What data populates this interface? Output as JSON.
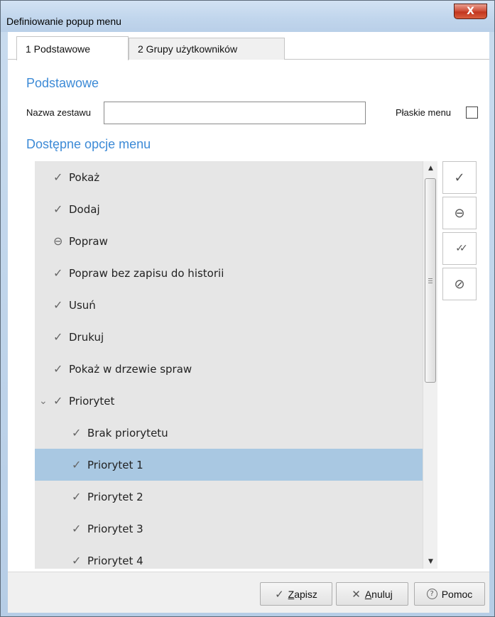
{
  "window": {
    "title": "Definiowanie popup menu",
    "close_glyph": "X"
  },
  "tabs": [
    {
      "label": "1 Podstawowe",
      "active": true
    },
    {
      "label": "2 Grupy użytkowników",
      "active": false
    }
  ],
  "basic_section": {
    "title": "Podstawowe",
    "name_label": "Nazwa zestawu",
    "name_value": "",
    "flat_menu_label": "Płaskie menu",
    "flat_menu_checked": false
  },
  "menu_section": {
    "title": "Dostępne opcje menu",
    "items": [
      {
        "label": "Pokaż",
        "icon": "check-icon",
        "glyph": "✓",
        "indent": 0,
        "selected": false
      },
      {
        "label": "Dodaj",
        "icon": "check-icon",
        "glyph": "✓",
        "indent": 0,
        "selected": false
      },
      {
        "label": "Popraw",
        "icon": "minus-circle-icon",
        "glyph": "⊖",
        "indent": 0,
        "selected": false
      },
      {
        "label": "Popraw bez zapisu do historii",
        "icon": "check-icon",
        "glyph": "✓",
        "indent": 0,
        "selected": false
      },
      {
        "label": "Usuń",
        "icon": "check-icon",
        "glyph": "✓",
        "indent": 0,
        "selected": false
      },
      {
        "label": "Drukuj",
        "icon": "check-icon",
        "glyph": "✓",
        "indent": 0,
        "selected": false
      },
      {
        "label": "Pokaż w drzewie spraw",
        "icon": "check-icon",
        "glyph": "✓",
        "indent": 0,
        "selected": false
      },
      {
        "label": "Priorytet",
        "icon": "check-icon",
        "glyph": "✓",
        "indent": 0,
        "selected": false,
        "expanded": true
      },
      {
        "label": "Brak priorytetu",
        "icon": "check-icon",
        "glyph": "✓",
        "indent": 1,
        "selected": false
      },
      {
        "label": "Priorytet 1",
        "icon": "check-icon",
        "glyph": "✓",
        "indent": 1,
        "selected": true
      },
      {
        "label": "Priorytet 2",
        "icon": "check-icon",
        "glyph": "✓",
        "indent": 1,
        "selected": false
      },
      {
        "label": "Priorytet 3",
        "icon": "check-icon",
        "glyph": "✓",
        "indent": 1,
        "selected": false
      },
      {
        "label": "Priorytet 4",
        "icon": "check-icon",
        "glyph": "✓",
        "indent": 1,
        "selected": false
      }
    ]
  },
  "side_buttons": [
    {
      "icon": "check-icon",
      "glyph": "✓"
    },
    {
      "icon": "minus-circle-icon",
      "glyph": "⊖"
    },
    {
      "icon": "double-check-icon",
      "glyph": "✓✓"
    },
    {
      "icon": "link-icon",
      "glyph": "⊘"
    }
  ],
  "footer": {
    "save_label": "Zapisz",
    "cancel_label": "Anuluj",
    "help_label": "Pomoc",
    "save_glyph": "✓",
    "cancel_glyph": "✕",
    "help_glyph": "?"
  },
  "colors": {
    "accent": "#3c8ad6",
    "selected_row": "#a9c8e2",
    "list_bg": "#e6e6e6"
  }
}
